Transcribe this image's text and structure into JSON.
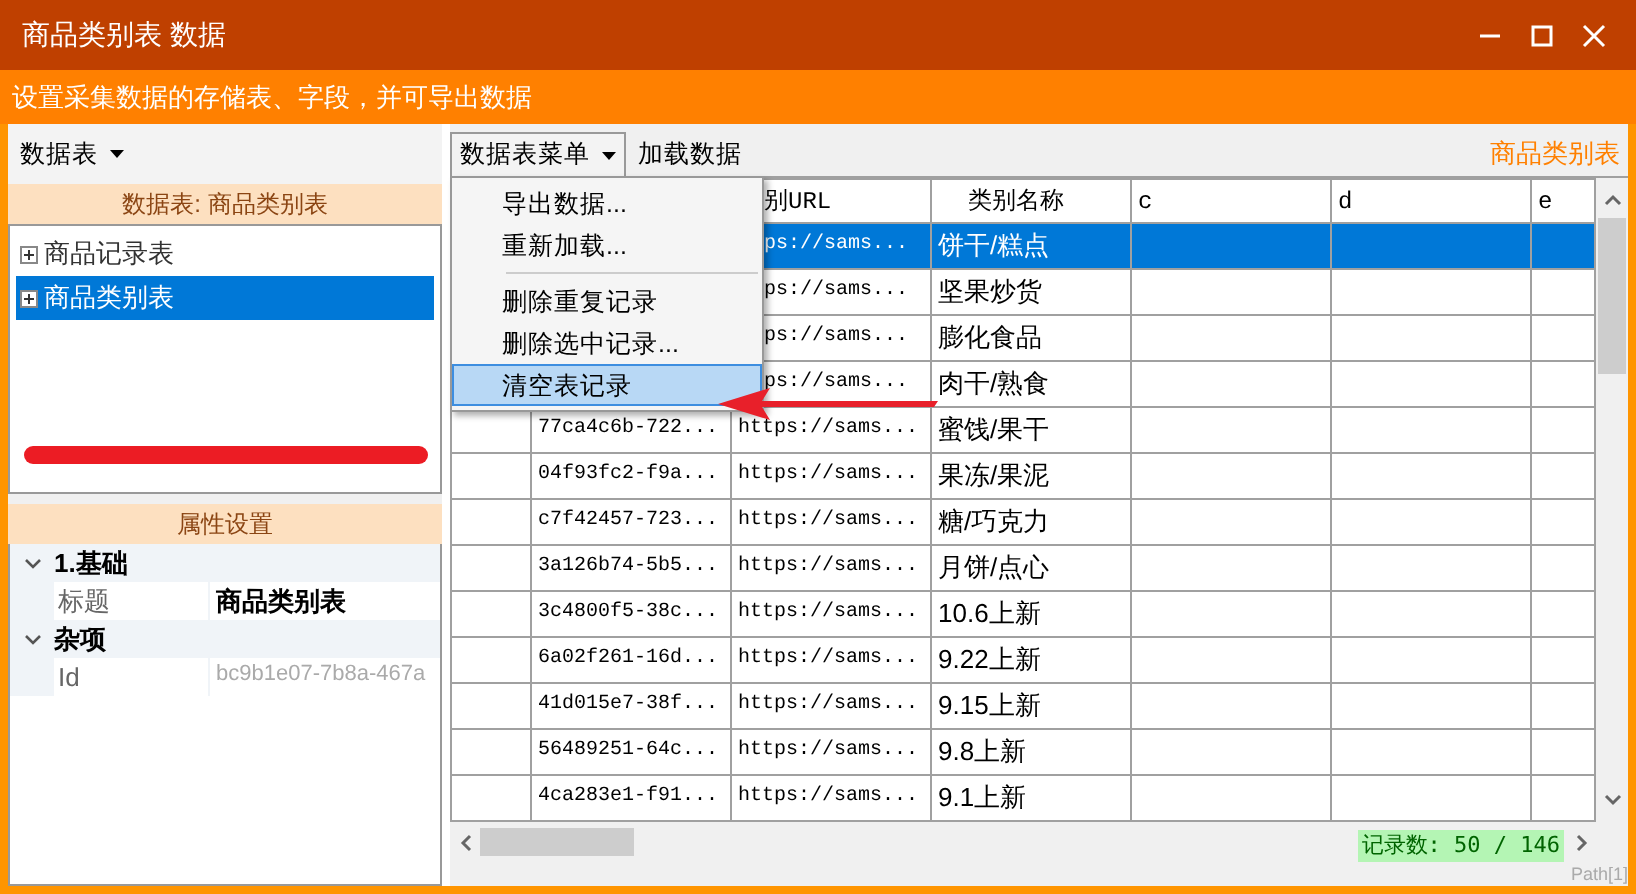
{
  "window": {
    "title": "商品类别表 数据"
  },
  "banner": "设置采集数据的存储表、字段，并可导出数据",
  "left_toolbar": {
    "dropdown": "数据表"
  },
  "table_panel": {
    "header": "数据表: 商品类别表",
    "items": [
      {
        "label": "商品记录表",
        "selected": false,
        "expanded": false
      },
      {
        "label": "商品类别表",
        "selected": true,
        "expanded": false
      }
    ]
  },
  "properties": {
    "header": "属性设置",
    "categories": [
      {
        "label": "1.基础",
        "expanded": true,
        "items": [
          {
            "name": "标题",
            "value": "商品类别表",
            "readonly": false
          }
        ]
      },
      {
        "label": "杂项",
        "expanded": true,
        "items": [
          {
            "name": "Id",
            "value": "bc9b1e07-7b8a-467a",
            "readonly": true
          }
        ]
      }
    ]
  },
  "toolbar": {
    "menu_button": "数据表菜单",
    "load_button": "加载数据",
    "current_table": "商品类别表"
  },
  "menu": {
    "items": [
      {
        "label": "导出数据...",
        "kind": "item",
        "selected": false
      },
      {
        "label": "重新加载...",
        "kind": "item",
        "selected": false
      },
      {
        "kind": "separator"
      },
      {
        "label": "删除重复记录",
        "kind": "item",
        "selected": false
      },
      {
        "label": "删除选中记录...",
        "kind": "item",
        "selected": false
      },
      {
        "label": "清空表记录",
        "kind": "item",
        "selected": true
      }
    ]
  },
  "grid": {
    "columns": [
      "别URL",
      "类别名称",
      "c",
      "d",
      "e"
    ],
    "rows": [
      {
        "url": "ps://sams...",
        "name": "饼干/糕点",
        "selected": true
      },
      {
        "url": "ps://sams...",
        "name": "坚果炒货",
        "selected": false
      },
      {
        "url": "ps://sams...",
        "name": "膨化食品",
        "selected": false
      },
      {
        "url": "ps://sams...",
        "name": "肉干/熟食",
        "selected": false
      },
      {
        "id": "77ca4c6b-722...",
        "url": "https://sams...",
        "name": "蜜饯/果干",
        "selected": false
      },
      {
        "id": "04f93fc2-f9a...",
        "url": "https://sams...",
        "name": "果冻/果泥",
        "selected": false
      },
      {
        "id": "c7f42457-723...",
        "url": "https://sams...",
        "name": "糖/巧克力",
        "selected": false
      },
      {
        "id": "3a126b74-5b5...",
        "url": "https://sams...",
        "name": "月饼/点心",
        "selected": false
      },
      {
        "id": "3c4800f5-38c...",
        "url": "https://sams...",
        "name": "10.6上新",
        "selected": false
      },
      {
        "id": "6a02f261-16d...",
        "url": "https://sams...",
        "name": "9.22上新",
        "selected": false
      },
      {
        "id": "41d015e7-38f...",
        "url": "https://sams...",
        "name": "9.15上新",
        "selected": false
      },
      {
        "id": "56489251-64c...",
        "url": "https://sams...",
        "name": "9.8上新",
        "selected": false
      },
      {
        "id": "4ca283e1-f91...",
        "url": "https://sams...",
        "name": "9.1上新",
        "selected": false
      }
    ]
  },
  "status": {
    "record_count": "记录数: 50 / 146",
    "path": "Path[1]"
  }
}
